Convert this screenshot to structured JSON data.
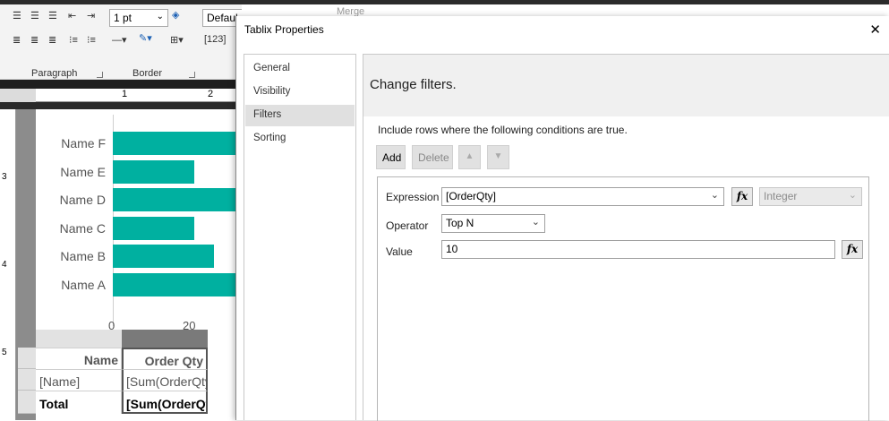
{
  "ribbon": {
    "font_size": "1 pt",
    "style_value": "Defaul",
    "merge_label": "Merge",
    "paragraph_label": "Paragraph",
    "border_label": "Border"
  },
  "ruler": {
    "h_marks": [
      "1",
      "2"
    ],
    "v_marks": [
      "3",
      "4",
      "5"
    ]
  },
  "chart_data": {
    "type": "bar",
    "categories": [
      "Name F",
      "Name E",
      "Name D",
      "Name C",
      "Name B",
      "Name A"
    ],
    "x_ticks": [
      "0",
      "20"
    ]
  },
  "table": {
    "headers": [
      "Name",
      "Order Qty"
    ],
    "rows": [
      [
        "[Name]",
        "[Sum(OrderQty"
      ],
      [
        "Total",
        "[Sum(OrderQt"
      ]
    ]
  },
  "dialog": {
    "title": "Tablix Properties",
    "close_glyph": "✕",
    "nav": [
      {
        "label": "General",
        "selected": false
      },
      {
        "label": "Visibility",
        "selected": false
      },
      {
        "label": "Filters",
        "selected": true
      },
      {
        "label": "Sorting",
        "selected": false
      }
    ],
    "page_title": "Change filters.",
    "description": "Include rows where the following conditions are true.",
    "buttons": {
      "add": "Add",
      "delete": "Delete"
    },
    "filter": {
      "expression_label": "Expression",
      "expression_value": "[OrderQty]",
      "type_value": "Integer",
      "operator_label": "Operator",
      "operator_value": "Top N",
      "value_label": "Value",
      "value_value": "10",
      "fx": "fx"
    }
  },
  "colors": {
    "bar": "#00b0a0",
    "selected_nav": "#e0e0e0"
  }
}
